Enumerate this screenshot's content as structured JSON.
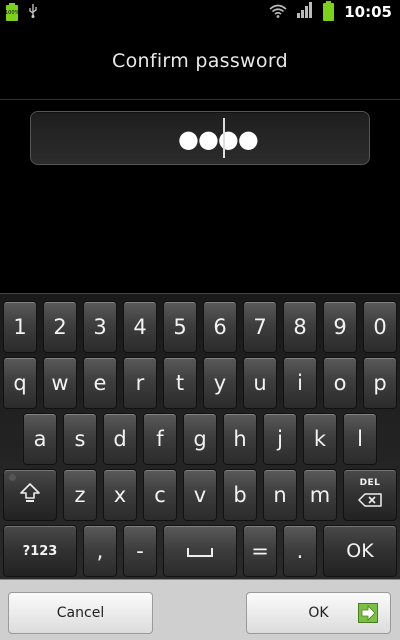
{
  "status_bar": {
    "battery_small_label": "100%",
    "usb_icon": "usb-icon",
    "wifi_icon": "wifi-icon",
    "signal_icon": "signal-icon",
    "battery_icon": "battery-icon",
    "time": "10:05",
    "accent_color": "#7cd21a"
  },
  "header": {
    "title": "Confirm password"
  },
  "password_field": {
    "masked_value": "●●●●"
  },
  "keyboard": {
    "row1": [
      "1",
      "2",
      "3",
      "4",
      "5",
      "6",
      "7",
      "8",
      "9",
      "0"
    ],
    "row2": [
      "q",
      "w",
      "e",
      "r",
      "t",
      "y",
      "u",
      "i",
      "o",
      "p"
    ],
    "row3": [
      "a",
      "s",
      "d",
      "f",
      "g",
      "h",
      "j",
      "k",
      "l"
    ],
    "row4": [
      "z",
      "x",
      "c",
      "v",
      "b",
      "n",
      "m"
    ],
    "shift_icon": "shift-icon",
    "del_label": "DEL",
    "del_icon": "backspace-icon",
    "symbols_label": "?123",
    "comma_label": ",",
    "dash_label": "-",
    "space_icon": "space-icon",
    "equals_label": "=",
    "period_label": ".",
    "ok_label": "OK"
  },
  "bottom_bar": {
    "cancel_label": "Cancel",
    "ok_label": "OK",
    "ok_icon": "next-arrow-icon",
    "ok_icon_color": "#7ac142"
  }
}
